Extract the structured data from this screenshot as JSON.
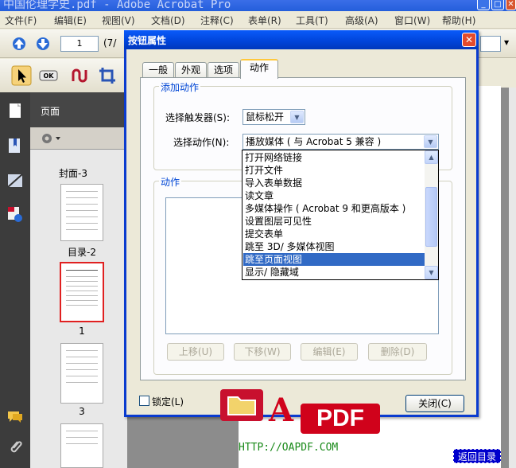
{
  "app": {
    "title": "中国伦理学史.pdf - Adobe Acrobat Pro"
  },
  "menu": [
    "文件(F)",
    "编辑(E)",
    "视图(V)",
    "文档(D)",
    "注释(C)",
    "表单(R)",
    "工具(T)",
    "高级(A)",
    "窗口(W)",
    "帮助(H)"
  ],
  "toolbar": {
    "page_number": "1",
    "page_total": "(7/"
  },
  "nav_panel": {
    "title": "页面",
    "thumbs": [
      "封面-3",
      "目录-2",
      "1",
      "3"
    ]
  },
  "dialog": {
    "title": "按钮属性",
    "close_glyph": "✕",
    "tabs": [
      "一般",
      "外观",
      "选项",
      "动作"
    ],
    "active_tab": "动作",
    "add_action_group": "添加动作",
    "trigger_label": "选择触发器(S):",
    "trigger_value": "鼠标松开",
    "action_label": "选择动作(N):",
    "action_value": "播放媒体 ( 与 Acrobat 5 兼容 )",
    "action_options": [
      "打开网络链接",
      "打开文件",
      "导入表单数据",
      "读文章",
      "多媒体操作 ( Acrobat 9 和更高版本 )",
      "设置图层可见性",
      "提交表单",
      "跳至 3D/ 多媒体视图",
      "跳至页面视图",
      "显示/ 隐藏域"
    ],
    "selected_option_index": 8,
    "actions_group": "动作",
    "buttons": {
      "up": "上移(U)",
      "down": "下移(W)",
      "edit": "编辑(E)",
      "delete": "删除(D)"
    },
    "lock_label": "锁定(L)",
    "close_button": "关闭(C)"
  },
  "watermark": {
    "a": "A",
    "pdf": "PDF",
    "url": "HTTP://OAPDF.COM",
    "back": "返回目录"
  },
  "colors": {
    "dialog_border": "#0a3bcf",
    "selection": "#316ac5",
    "group_title": "#0046d5",
    "watermark_red": "#d0021b"
  },
  "icons": [
    "up-arrow-icon",
    "down-arrow-icon",
    "select-arrow-icon",
    "ok-button-icon",
    "link-tool-icon",
    "crop-icon",
    "pages-icon",
    "bookmarks-icon",
    "signatures-icon",
    "attachments-icon",
    "comments-icon",
    "gear-icon"
  ]
}
